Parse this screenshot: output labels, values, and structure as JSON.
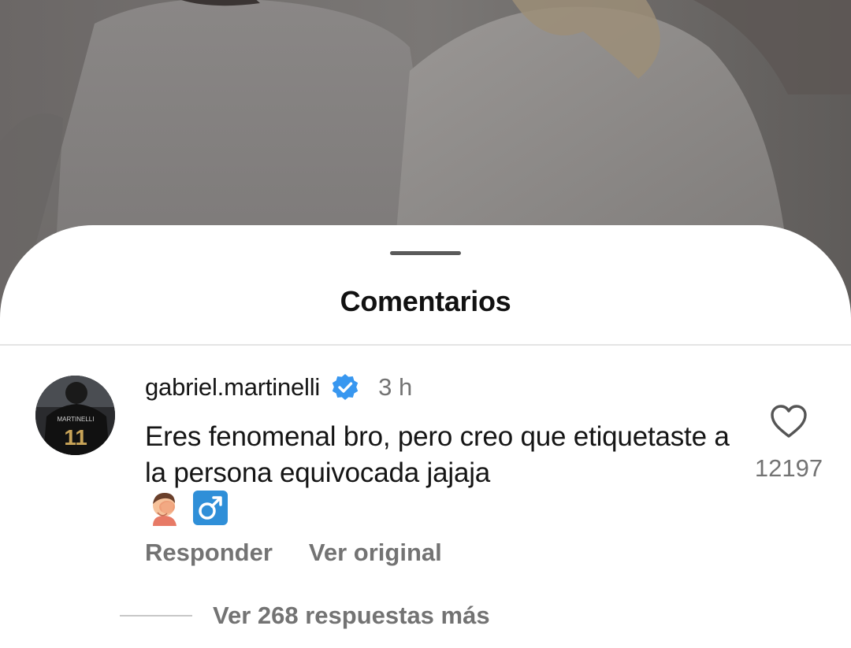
{
  "sheet": {
    "title": "Comentarios"
  },
  "comment": {
    "username": "gabriel.martinelli",
    "verified_icon": "verified-badge-icon",
    "verified_color": "#3897f0",
    "timestamp": "3 h",
    "avatar_jersey_text": "MARTINELLI",
    "avatar_jersey_number": "11",
    "text": "Eres fenomenal bro, pero creo que etiquetaste a la persona equivocada jajaja",
    "emojis": [
      "face-palm-emoji",
      "male-sign-emoji"
    ],
    "like_icon": "heart-outline-icon",
    "like_count": "12197",
    "actions": {
      "reply": "Responder",
      "see_original": "Ver original"
    },
    "replies_label": "Ver 268 respuestas más"
  },
  "colors": {
    "text_primary": "#151515",
    "text_secondary": "#737373",
    "divider": "#e4e4e4"
  }
}
